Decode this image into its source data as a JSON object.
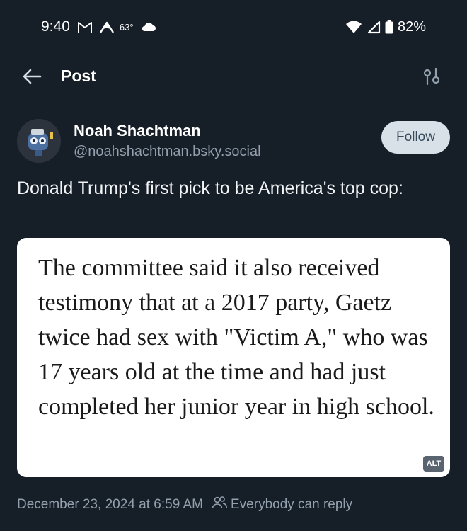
{
  "status_bar": {
    "time": "9:40",
    "temperature": "63°",
    "battery": "82%",
    "icons": [
      "gmail-icon",
      "mountain-icon",
      "cloud-icon",
      "wifi-icon",
      "signal-icon",
      "battery-icon"
    ]
  },
  "header": {
    "title": "Post",
    "back_icon": "back-arrow-icon",
    "settings_icon": "sliders-icon"
  },
  "post": {
    "author": {
      "name": "Noah Shachtman",
      "handle": "@noahshachtman.bsky.social"
    },
    "follow_label": "Follow",
    "text": "Donald Trump's first pick to be America's top cop:",
    "image": {
      "text": "The committee said it also received testimony that at a 2017 party, Gaetz twice had sex with \"Victim A,\" who was 17 years old at the time and had just completed her junior year in high school.",
      "alt_badge": "ALT"
    },
    "timestamp": "December 23, 2024 at 6:59 AM",
    "reply_setting": "Everybody can reply"
  },
  "colors": {
    "background": "#161e27",
    "follow_bg": "#d9e1e8",
    "muted_text": "#93a0ae"
  }
}
